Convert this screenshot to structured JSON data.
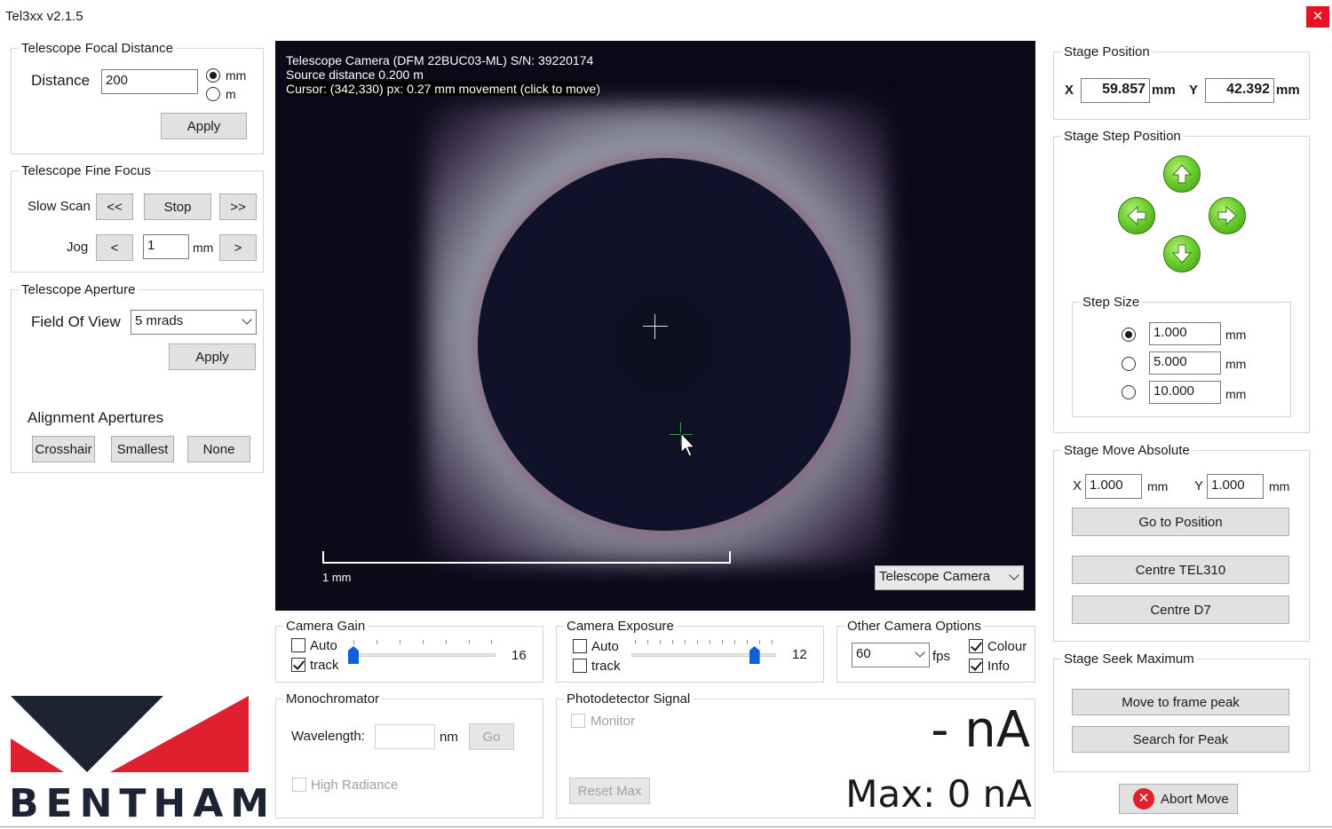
{
  "window": {
    "title": "Tel3xx v2.1.5",
    "close_glyph": "✕"
  },
  "focal": {
    "legend": "Telescope Focal Distance",
    "distance_label": "Distance",
    "distance_value": "200",
    "unit_mm": "mm",
    "unit_m": "m",
    "selected_unit": "mm",
    "apply": "Apply"
  },
  "fine_focus": {
    "legend": "Telescope Fine Focus",
    "slow_scan_label": "Slow Scan",
    "rewind": "<<",
    "stop": "Stop",
    "forward": ">>",
    "jog_label": "Jog",
    "jog_back": "<",
    "jog_value": "1",
    "jog_unit": "mm",
    "jog_fwd": ">"
  },
  "aperture": {
    "legend": "Telescope Aperture",
    "fov_label": "Field Of View",
    "fov_value": "5 mrads",
    "apply": "Apply",
    "alignment_label": "Alignment Apertures",
    "crosshair": "Crosshair",
    "smallest": "Smallest",
    "none": "None"
  },
  "logo": {
    "text": "BENTHAM",
    "colors": {
      "red": "#e0202e",
      "navy": "#1c2333"
    }
  },
  "camera": {
    "line1": "Telescope Camera (DFM 22BUC03-ML) S/N: 39220174",
    "line2": "Source distance 0.200 m",
    "line3": "Cursor: (342,330) px: 0.27 mm movement (click to move)",
    "scale_label": "1 mm",
    "source_select": "Telescope Camera"
  },
  "gain": {
    "legend": "Camera Gain",
    "auto": "Auto",
    "track": "track",
    "auto_checked": false,
    "track_checked": true,
    "value": "16",
    "level": 0.0
  },
  "exposure": {
    "legend": "Camera Exposure",
    "auto": "Auto",
    "track": "track",
    "auto_checked": false,
    "track_checked": false,
    "value": "12",
    "level": 0.86
  },
  "other": {
    "legend": "Other Camera Options",
    "fps_value": "60",
    "fps_label": "fps",
    "colour": "Colour",
    "info": "Info",
    "colour_checked": true,
    "info_checked": true
  },
  "mono": {
    "legend": "Monochromator",
    "wavelength_label": "Wavelength:",
    "wavelength_value": "",
    "unit": "nm",
    "go": "Go",
    "high_radiance": "High Radiance"
  },
  "photo": {
    "legend": "Photodetector Signal",
    "monitor": "Monitor",
    "reset_max": "Reset Max",
    "signal": "- nA",
    "max": "Max: 0 nA"
  },
  "stage_pos": {
    "legend": "Stage Position",
    "x_label": "X",
    "x_value": "59.857",
    "y_label": "Y",
    "y_value": "42.392",
    "unit": "mm"
  },
  "stage_step": {
    "legend": "Stage Step Position",
    "step_size_legend": "Step Size",
    "sizes": [
      {
        "value": "1.000",
        "unit": "mm",
        "selected": true
      },
      {
        "value": "5.000",
        "unit": "mm",
        "selected": false
      },
      {
        "value": "10.000",
        "unit": "mm",
        "selected": false
      }
    ]
  },
  "stage_abs": {
    "legend": "Stage Move Absolute",
    "x_label": "X",
    "x_value": "1.000",
    "x_unit": "mm",
    "y_label": "Y",
    "y_value": "1.000",
    "y_unit": "mm",
    "go_to": "Go to Position",
    "centre_tel": "Centre TEL310",
    "centre_d7": "Centre D7"
  },
  "stage_seek": {
    "legend": "Stage Seek Maximum",
    "move_frame": "Move to frame peak",
    "search_peak": "Search for Peak"
  },
  "abort": {
    "label": "Abort Move",
    "icon_glyph": "✕"
  }
}
